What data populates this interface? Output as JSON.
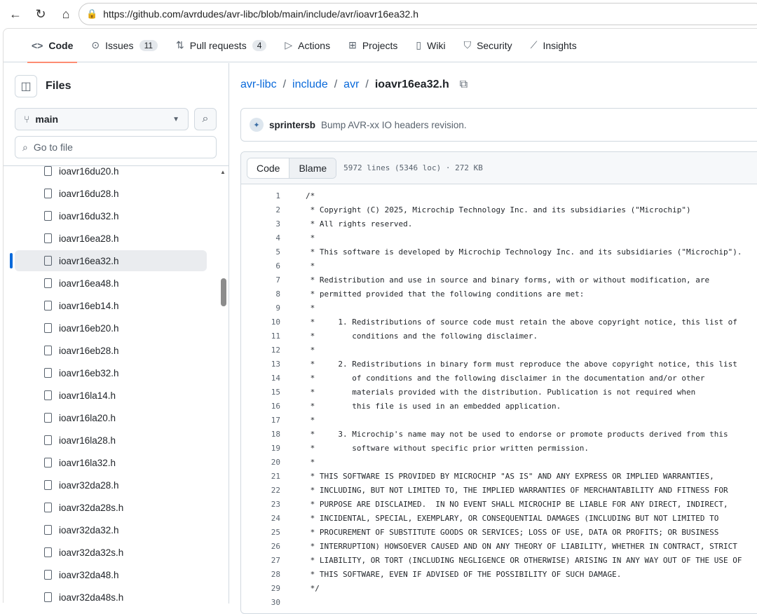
{
  "browser": {
    "url": "https://github.com/avrdudes/avr-libc/blob/main/include/avr/ioavr16ea32.h"
  },
  "repo_nav": [
    {
      "label": "Code",
      "icon": "code-icon",
      "selected": true
    },
    {
      "label": "Issues",
      "icon": "issue-icon",
      "count": "11"
    },
    {
      "label": "Pull requests",
      "icon": "pull-request-icon",
      "count": "4"
    },
    {
      "label": "Actions",
      "icon": "play-icon"
    },
    {
      "label": "Projects",
      "icon": "table-icon"
    },
    {
      "label": "Wiki",
      "icon": "book-icon"
    },
    {
      "label": "Security",
      "icon": "shield-icon"
    },
    {
      "label": "Insights",
      "icon": "graph-icon"
    }
  ],
  "sidebar": {
    "title": "Files",
    "branch": "main",
    "search_placeholder": "Go to file",
    "files": [
      "ioavr16du20.h",
      "ioavr16du28.h",
      "ioavr16du32.h",
      "ioavr16ea28.h",
      "ioavr16ea32.h",
      "ioavr16ea48.h",
      "ioavr16eb14.h",
      "ioavr16eb20.h",
      "ioavr16eb28.h",
      "ioavr16eb32.h",
      "ioavr16la14.h",
      "ioavr16la20.h",
      "ioavr16la28.h",
      "ioavr16la32.h",
      "ioavr32da28.h",
      "ioavr32da28s.h",
      "ioavr32da32.h",
      "ioavr32da32s.h",
      "ioavr32da48.h",
      "ioavr32da48s.h"
    ],
    "selected": "ioavr16ea32.h"
  },
  "breadcrumb": {
    "parts": [
      "avr-libc",
      "include",
      "avr"
    ],
    "sep": "/",
    "current": "ioavr16ea32.h"
  },
  "commit": {
    "author": "sprintersb",
    "message": "Bump AVR-xx IO headers revision."
  },
  "file": {
    "tab_code": "Code",
    "tab_blame": "Blame",
    "meta": "5972 lines (5346 loc) · 272 KB",
    "lines": [
      "/*",
      " * Copyright (C) 2025, Microchip Technology Inc. and its subsidiaries (\"Microchip\")",
      " * All rights reserved.",
      " *",
      " * This software is developed by Microchip Technology Inc. and its subsidiaries (\"Microchip\").",
      " *",
      " * Redistribution and use in source and binary forms, with or without modification, are",
      " * permitted provided that the following conditions are met:",
      " *",
      " *     1. Redistributions of source code must retain the above copyright notice, this list of",
      " *        conditions and the following disclaimer.",
      " *",
      " *     2. Redistributions in binary form must reproduce the above copyright notice, this list",
      " *        of conditions and the following disclaimer in the documentation and/or other",
      " *        materials provided with the distribution. Publication is not required when",
      " *        this file is used in an embedded application.",
      " *",
      " *     3. Microchip's name may not be used to endorse or promote products derived from this",
      " *        software without specific prior written permission.",
      " *",
      " * THIS SOFTWARE IS PROVIDED BY MICROCHIP \"AS IS\" AND ANY EXPRESS OR IMPLIED WARRANTIES,",
      " * INCLUDING, BUT NOT LIMITED TO, THE IMPLIED WARRANTIES OF MERCHANTABILITY AND FITNESS FOR",
      " * PURPOSE ARE DISCLAIMED.  IN NO EVENT SHALL MICROCHIP BE LIABLE FOR ANY DIRECT, INDIRECT,",
      " * INCIDENTAL, SPECIAL, EXEMPLARY, OR CONSEQUENTIAL DAMAGES (INCLUDING BUT NOT LIMITED TO",
      " * PROCUREMENT OF SUBSTITUTE GOODS OR SERVICES; LOSS OF USE, DATA OR PROFITS; OR BUSINESS",
      " * INTERRUPTION) HOWSOEVER CAUSED AND ON ANY THEORY OF LIABILITY, WHETHER IN CONTRACT, STRICT",
      " * LIABILITY, OR TORT (INCLUDING NEGLIGENCE OR OTHERWISE) ARISING IN ANY WAY OUT OF THE USE OF",
      " * THIS SOFTWARE, EVEN IF ADVISED OF THE POSSIBILITY OF SUCH DAMAGE.",
      " */",
      ""
    ]
  }
}
